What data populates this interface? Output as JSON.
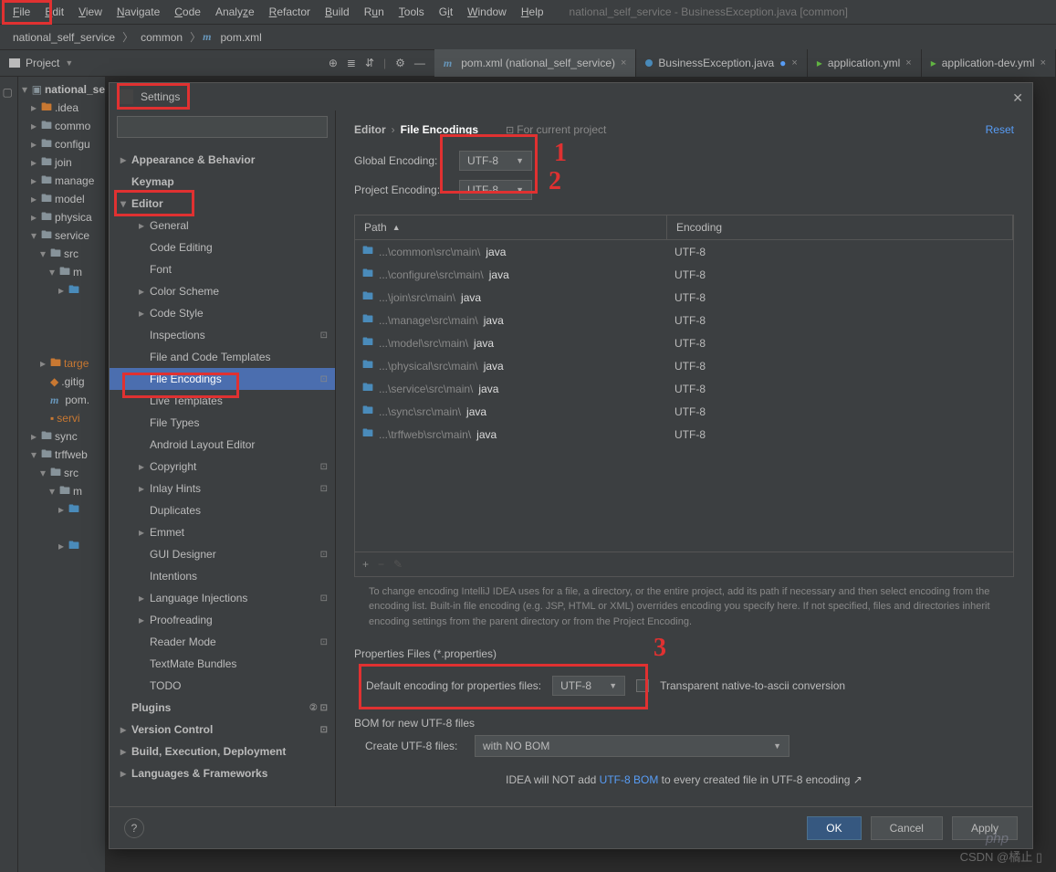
{
  "menu": [
    "File",
    "Edit",
    "View",
    "Navigate",
    "Code",
    "Analyze",
    "Refactor",
    "Build",
    "Run",
    "Tools",
    "Git",
    "Window",
    "Help"
  ],
  "window_title": "national_self_service - BusinessException.java [common]",
  "breadcrumb": {
    "root": "national_self_service",
    "mid": "common",
    "file": "pom.xml"
  },
  "project_label": "Project",
  "tabs": [
    {
      "icon": "m",
      "color": "#6897bb",
      "label": "pom.xml (national_self_service)",
      "active": true
    },
    {
      "icon": "dot",
      "color": "#4a8bba",
      "label": "BusinessException.java",
      "active": false,
      "xtra": "●"
    },
    {
      "icon": "yml",
      "color": "#62b543",
      "label": "application.yml",
      "active": false
    },
    {
      "icon": "yml",
      "color": "#62b543",
      "label": "application-dev.yml",
      "active": false
    }
  ],
  "project_tree": [
    {
      "d": 0,
      "a": "▾",
      "ico": "mod",
      "txt": "national_se",
      "bold": true
    },
    {
      "d": 1,
      "a": "▸",
      "ico": "dir-o",
      "txt": ".idea"
    },
    {
      "d": 1,
      "a": "▸",
      "ico": "dir",
      "txt": "commo"
    },
    {
      "d": 1,
      "a": "▸",
      "ico": "dir",
      "txt": "configu"
    },
    {
      "d": 1,
      "a": "▸",
      "ico": "dir",
      "txt": "join"
    },
    {
      "d": 1,
      "a": "▸",
      "ico": "dir",
      "txt": "manage"
    },
    {
      "d": 1,
      "a": "▸",
      "ico": "dir",
      "txt": "model"
    },
    {
      "d": 1,
      "a": "▸",
      "ico": "dir",
      "txt": "physica"
    },
    {
      "d": 1,
      "a": "▾",
      "ico": "dir",
      "txt": "service"
    },
    {
      "d": 2,
      "a": "▾",
      "ico": "dir",
      "txt": "src"
    },
    {
      "d": 3,
      "a": "▾",
      "ico": "dir",
      "txt": "m"
    },
    {
      "d": 4,
      "a": "▸",
      "ico": "dir-b",
      "txt": ""
    },
    {
      "d": 4,
      "a": " ",
      "ico": "",
      "txt": ""
    },
    {
      "d": 4,
      "a": " ",
      "ico": "",
      "txt": ""
    },
    {
      "d": 4,
      "a": " ",
      "ico": "",
      "txt": ""
    },
    {
      "d": 2,
      "a": "▸",
      "ico": "dir-o",
      "txt": "targe",
      "orange": true
    },
    {
      "d": 2,
      "a": " ",
      "ico": "git",
      "txt": ".gitig"
    },
    {
      "d": 2,
      "a": " ",
      "ico": "m",
      "txt": "pom."
    },
    {
      "d": 2,
      "a": " ",
      "ico": "file",
      "txt": "servi",
      "orange": true
    },
    {
      "d": 1,
      "a": "▸",
      "ico": "dir",
      "txt": "sync"
    },
    {
      "d": 1,
      "a": "▾",
      "ico": "dir",
      "txt": "trffweb"
    },
    {
      "d": 2,
      "a": "▾",
      "ico": "dir",
      "txt": "src"
    },
    {
      "d": 3,
      "a": "▾",
      "ico": "dir",
      "txt": "m"
    },
    {
      "d": 4,
      "a": "▸",
      "ico": "dir-b",
      "txt": ""
    },
    {
      "d": 4,
      "a": " ",
      "ico": "",
      "txt": ""
    },
    {
      "d": 4,
      "a": "▸",
      "ico": "dir-b",
      "txt": ""
    }
  ],
  "dialog": {
    "title": "Settings",
    "search_placeholder": "",
    "tree": [
      {
        "txt": "Appearance & Behavior",
        "lvl": 0,
        "bold": true,
        "arrow": "▸"
      },
      {
        "txt": "Keymap",
        "lvl": 0,
        "bold": true
      },
      {
        "txt": "Editor",
        "lvl": 0,
        "bold": true,
        "arrow": "▾"
      },
      {
        "txt": "General",
        "lvl": 1,
        "arrow": "▸"
      },
      {
        "txt": "Code Editing",
        "lvl": 1
      },
      {
        "txt": "Font",
        "lvl": 1
      },
      {
        "txt": "Color Scheme",
        "lvl": 1,
        "arrow": "▸"
      },
      {
        "txt": "Code Style",
        "lvl": 1,
        "arrow": "▸"
      },
      {
        "txt": "Inspections",
        "lvl": 1,
        "badge": "⊡"
      },
      {
        "txt": "File and Code Templates",
        "lvl": 1
      },
      {
        "txt": "File Encodings",
        "lvl": 1,
        "selected": true,
        "badge": "⊡"
      },
      {
        "txt": "Live Templates",
        "lvl": 1
      },
      {
        "txt": "File Types",
        "lvl": 1
      },
      {
        "txt": "Android Layout Editor",
        "lvl": 1
      },
      {
        "txt": "Copyright",
        "lvl": 1,
        "arrow": "▸",
        "badge": "⊡"
      },
      {
        "txt": "Inlay Hints",
        "lvl": 1,
        "arrow": "▸",
        "badge": "⊡"
      },
      {
        "txt": "Duplicates",
        "lvl": 1
      },
      {
        "txt": "Emmet",
        "lvl": 1,
        "arrow": "▸"
      },
      {
        "txt": "GUI Designer",
        "lvl": 1,
        "badge": "⊡"
      },
      {
        "txt": "Intentions",
        "lvl": 1
      },
      {
        "txt": "Language Injections",
        "lvl": 1,
        "arrow": "▸",
        "badge": "⊡"
      },
      {
        "txt": "Proofreading",
        "lvl": 1,
        "arrow": "▸"
      },
      {
        "txt": "Reader Mode",
        "lvl": 1,
        "badge": "⊡"
      },
      {
        "txt": "TextMate Bundles",
        "lvl": 1
      },
      {
        "txt": "TODO",
        "lvl": 1
      },
      {
        "txt": "Plugins",
        "lvl": 0,
        "bold": true,
        "badge": "② ⊡"
      },
      {
        "txt": "Version Control",
        "lvl": 0,
        "bold": true,
        "arrow": "▸",
        "badge": "⊡"
      },
      {
        "txt": "Build, Execution, Deployment",
        "lvl": 0,
        "bold": true,
        "arrow": "▸"
      },
      {
        "txt": "Languages & Frameworks",
        "lvl": 0,
        "bold": true,
        "arrow": "▸"
      }
    ],
    "bc_editor": "Editor",
    "bc_file_enc": "File Encodings",
    "for_project": "For current project",
    "reset": "Reset",
    "global_enc_label": "Global Encoding:",
    "global_enc_val": "UTF-8",
    "project_enc_label": "Project Encoding:",
    "project_enc_val": "UTF-8",
    "th_path": "Path",
    "th_enc": "Encoding",
    "rows": [
      {
        "p": "...\\common\\src\\main\\",
        "f": "java",
        "e": "UTF-8"
      },
      {
        "p": "...\\configure\\src\\main\\",
        "f": "java",
        "e": "UTF-8"
      },
      {
        "p": "...\\join\\src\\main\\",
        "f": "java",
        "e": "UTF-8"
      },
      {
        "p": "...\\manage\\src\\main\\",
        "f": "java",
        "e": "UTF-8"
      },
      {
        "p": "...\\model\\src\\main\\",
        "f": "java",
        "e": "UTF-8"
      },
      {
        "p": "...\\physical\\src\\main\\",
        "f": "java",
        "e": "UTF-8"
      },
      {
        "p": "...\\service\\src\\main\\",
        "f": "java",
        "e": "UTF-8"
      },
      {
        "p": "...\\sync\\src\\main\\",
        "f": "java",
        "e": "UTF-8"
      },
      {
        "p": "...\\trffweb\\src\\main\\",
        "f": "java",
        "e": "UTF-8"
      }
    ],
    "help_text": "To change encoding IntelliJ IDEA uses for a file, a directory, or the entire project, add its path if necessary and then select encoding from the encoding list. Built-in file encoding (e.g. JSP, HTML or XML) overrides encoding you specify here. If not specified, files and directories inherit encoding settings from the parent directory or from the Project Encoding.",
    "props_label": "Properties Files (*.properties)",
    "default_enc_label": "Default encoding for properties files:",
    "default_enc_val": "UTF-8",
    "transparent_label": "Transparent native-to-ascii conversion",
    "bom_label": "BOM for new UTF-8 files",
    "create_label": "Create UTF-8 files:",
    "create_val": "with NO BOM",
    "bom_note_pre": "IDEA will NOT add ",
    "bom_note_link": "UTF-8 BOM",
    "bom_note_post": " to every created file in UTF-8 encoding ↗",
    "btn_ok": "OK",
    "btn_cancel": "Cancel",
    "btn_apply": "Apply"
  },
  "watermark": "CSDN @橘止 ▯",
  "watermark_php": "php"
}
